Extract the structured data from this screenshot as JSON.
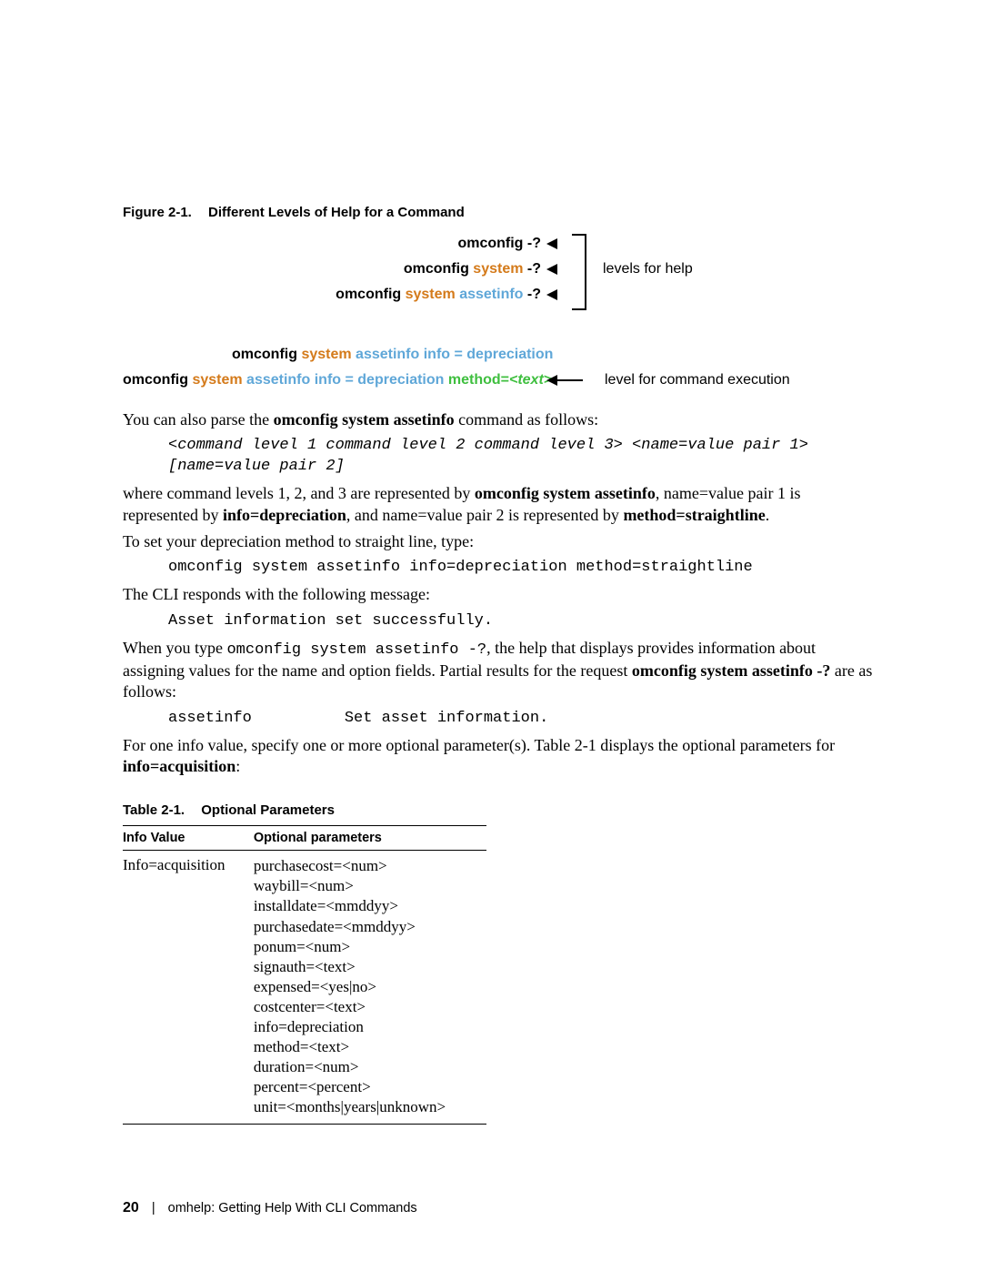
{
  "figure": {
    "label": "Figure 2-1.",
    "title": "Different Levels of Help for a Command",
    "lines": {
      "l1": "omconfig -?",
      "l2_a": "omconfig ",
      "l2_b": "system",
      "l2_c": " -?",
      "l3_a": "omconfig  ",
      "l3_b": "system",
      "l3_c": "  assetinfo",
      "l3_d": " -?",
      "l4_a": "omconfig  ",
      "l4_b": "system",
      "l4_c": "  assetinfo info = depreciation",
      "l5_a": "omconfig  ",
      "l5_b": "system",
      "l5_c": "  assetinfo info = depreciation ",
      "l5_d": "method=",
      "l5_e": "<text>",
      "right_help": "levels for help",
      "right_exec": "level for command execution"
    }
  },
  "body": {
    "p1_a": "You can also parse the ",
    "p1_b": "omconfig system assetinfo",
    "p1_c": " command as follows:",
    "code1": "<command level 1 command level 2 command level 3> <name=value pair 1>\n[name=value pair 2]",
    "p2_a": "where command levels 1, 2, and 3 are represented by ",
    "p2_b": "omconfig system assetinfo",
    "p2_c": ", name=value pair 1 is represented by ",
    "p2_d": "info=depreciation",
    "p2_e": ", and name=value pair 2 is represented by ",
    "p2_f": "method=straightline",
    "p2_g": ".",
    "p3": "To set your depreciation method to straight line, type:",
    "code2": "omconfig system assetinfo info=depreciation method=straightline",
    "p4": "The CLI responds with the following message:",
    "code3": "Asset information set successfully.",
    "p5_a": "When you type ",
    "p5_cmd": "omconfig system assetinfo -?",
    "p5_b": ", the help that displays provides information about assigning values for the name and option fields. Partial results for the request ",
    "p5_c": "omconfig system assetinfo -?",
    "p5_d": " are as follows:",
    "code4": "assetinfo          Set asset information.",
    "p6_a": "For one info value, specify one or more optional parameter(s). Table 2-1 displays the optional parameters for ",
    "p6_b": "info=acquisition",
    "p6_c": ":"
  },
  "table": {
    "label": "Table 2-1.",
    "title": "Optional Parameters",
    "headers": {
      "h1": "Info Value",
      "h2": "Optional parameters"
    },
    "row": {
      "info": "Info=acquisition",
      "params": [
        "purchasecost=<num>",
        "waybill=<num>",
        "installdate=<mmddyy>",
        "purchasedate=<mmddyy>",
        "ponum=<num>",
        "signauth=<text>",
        "expensed=<yes|no>",
        "costcenter=<text>",
        "info=depreciation",
        "method=<text>",
        "duration=<num>",
        "percent=<percent>",
        "unit=<months|years|unknown>"
      ]
    }
  },
  "footer": {
    "page": "20",
    "section": "omhelp: Getting Help With CLI Commands"
  }
}
